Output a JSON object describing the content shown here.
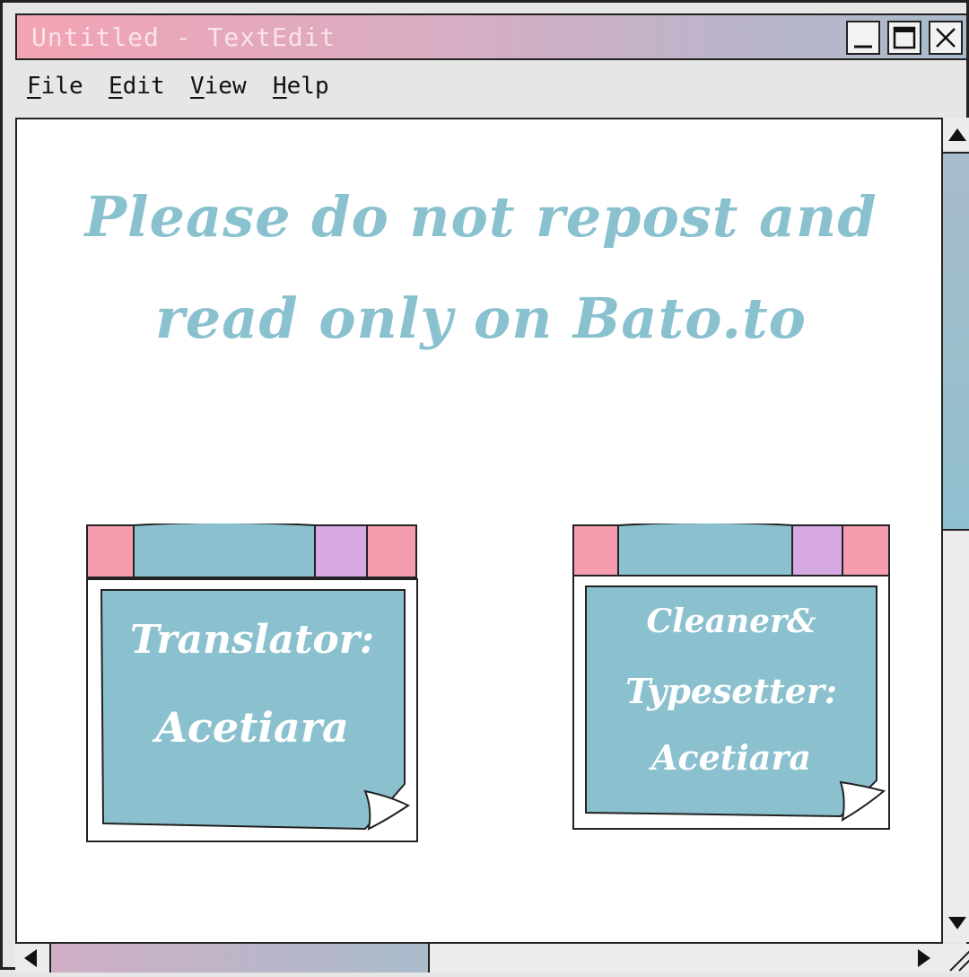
{
  "window": {
    "title": "Untitled - TextEdit",
    "controls": [
      "minimize-icon",
      "maximize-icon",
      "close-icon"
    ]
  },
  "menubar": {
    "items": [
      {
        "label": "File",
        "accel": "F",
        "rest": "ile"
      },
      {
        "label": "Edit",
        "accel": "E",
        "rest": "dit"
      },
      {
        "label": "View",
        "accel": "V",
        "rest": "iew"
      },
      {
        "label": "Help",
        "accel": "H",
        "rest": "elp"
      }
    ]
  },
  "document": {
    "heading_line1": "Please do not repost and",
    "heading_line2": "read only on Bato.to",
    "notes": [
      {
        "lines": [
          "Translator:",
          "Acetiara"
        ]
      },
      {
        "lines": [
          "Cleaner&",
          "Typesetter:",
          "Acetiara"
        ]
      }
    ]
  },
  "colors": {
    "note_blue": "#8bc1cf",
    "tab_pink": "#f59daf",
    "tab_lilac": "#d7a9e3",
    "heading_blue": "#89c1cf"
  }
}
